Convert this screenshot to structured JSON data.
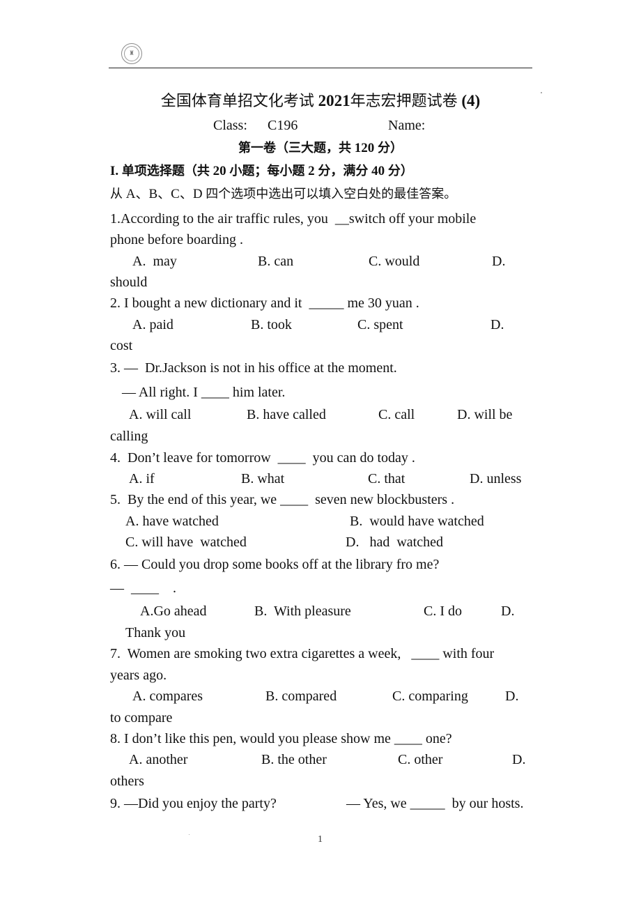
{
  "header": {
    "logo_icon": "school-emblem-icon"
  },
  "title": {
    "cjk_part1": "全国体育单招文化考试",
    "year": "2021",
    "cjk_part2": "年志宏押题试卷",
    "suffix": "(4)"
  },
  "class_info": {
    "class_label": "Class:",
    "class_value": "C196",
    "name_label": "Name:",
    "name_value": ""
  },
  "volume": {
    "cjk_part1": "第一卷（三大题，共",
    "score": "120",
    "cjk_part2": "分）"
  },
  "section": {
    "number": "I.",
    "cjk_part1": "单项选择题（共",
    "count": "20",
    "cjk_part2": "小题；每小题",
    "per": "2",
    "cjk_part3": "分，满分",
    "total": "40",
    "cjk_part4": "分）"
  },
  "instruction": {
    "cjk_prefix": "从",
    "letters": "A、B、C、D",
    "cjk_suffix": "四个选项中选出可以填入空白处的最佳答案。"
  },
  "questions": [
    {
      "lines": [
        "1.According to the air traffic rules, you  __switch off your mobile",
        "phone before boarding ."
      ],
      "options": [
        "A.  may",
        "B. can",
        "C. would",
        "D."
      ],
      "option_wrap": "should"
    },
    {
      "lines": [
        "2. I bought a new dictionary and it  _____ me 30 yuan ."
      ],
      "options": [
        "A. paid",
        "B. took",
        "C. spent",
        "D."
      ],
      "option_wrap": "cost"
    },
    {
      "lines": [
        "3. —  Dr.Jackson is not in his office at the moment.",
        "— All right. I ____ him later."
      ],
      "options": [
        "A. will call",
        "B. have called",
        "C. call",
        "D. will be"
      ],
      "option_wrap": "calling"
    },
    {
      "lines": [
        "4.  Don’t leave for tomorrow  ____  you can do today ."
      ],
      "options": [
        "A. if",
        "B. what",
        "C. that",
        "D. unless"
      ],
      "option_wrap": ""
    },
    {
      "lines": [
        "5.  By the end of this year, we ____  seven new blockbusters ."
      ],
      "options": [
        "A. have watched",
        "B.  would have watched",
        "C. will have  watched",
        "D.   had  watched"
      ],
      "option_wrap": ""
    },
    {
      "lines": [
        "6. — Could you drop some books off at the library fro me?",
        "—  ____    ."
      ],
      "options": [
        "A.Go ahead",
        "B.  With pleasure",
        "C. I do",
        "D."
      ],
      "option_wrap": "Thank you"
    },
    {
      "lines": [
        "7.  Women are smoking two extra cigarettes a week,   ____ with four",
        "years ago."
      ],
      "options": [
        "A. compares",
        "B. compared",
        "C. comparing",
        "D."
      ],
      "option_wrap": "to compare"
    },
    {
      "lines": [
        "8. I don’t like this pen, would you please show me ____ one?"
      ],
      "options": [
        "A. another",
        "B. the other",
        "C. other",
        "D."
      ],
      "option_wrap": "others"
    },
    {
      "lines": [
        "9. —Did you enjoy the party?",
        "— Yes, we _____  by our hosts."
      ],
      "options": [],
      "option_wrap": ""
    }
  ],
  "footer": {
    "page_number": "1"
  }
}
